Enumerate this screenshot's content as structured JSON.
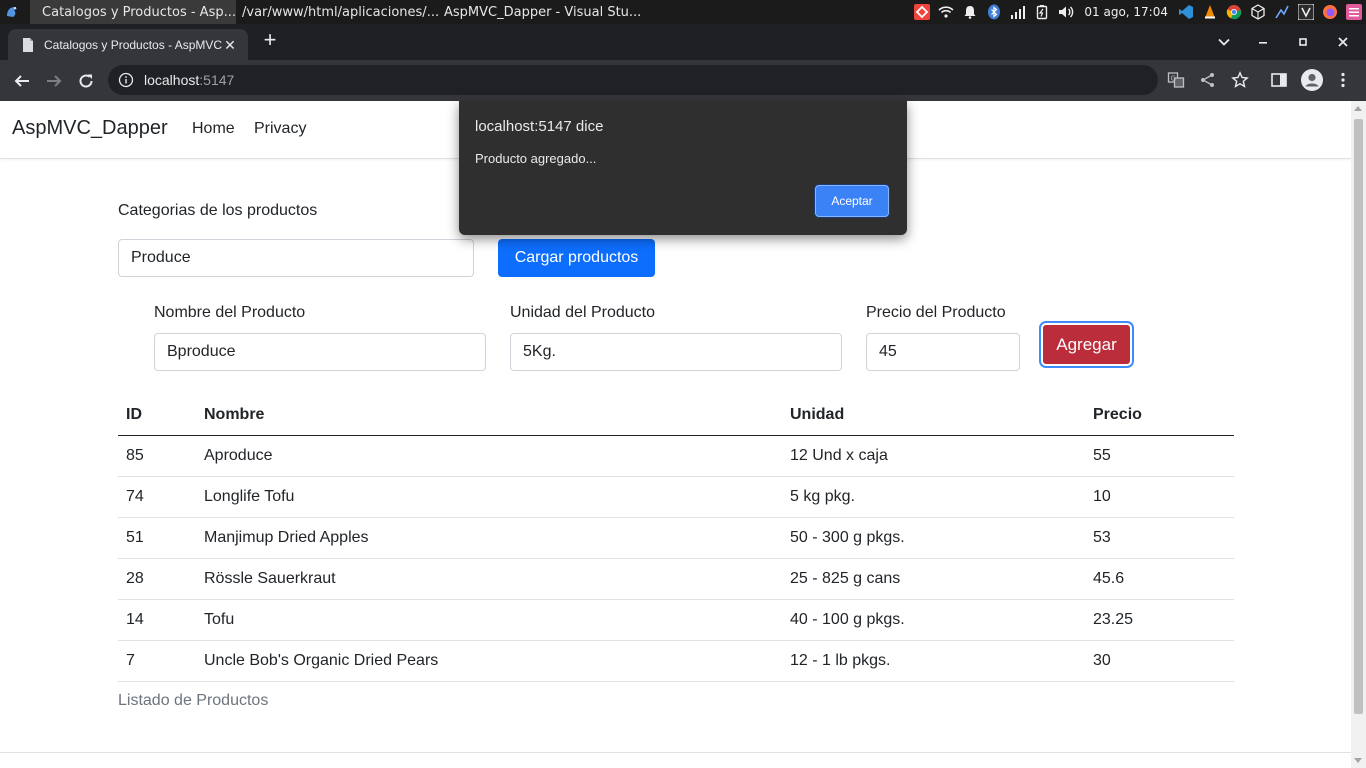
{
  "taskbar": {
    "tasks": [
      {
        "label": "Catalogos y Productos - Asp..."
      },
      {
        "label": "/var/www/html/aplicaciones/..."
      },
      {
        "label": "AspMVC_Dapper - Visual Stu..."
      }
    ],
    "clock": "01 ago, 17:04"
  },
  "browser": {
    "tab_title": "Catalogos y Productos - AspMVC_Dapper",
    "url_host": "localhost",
    "url_port": ":5147"
  },
  "app": {
    "brand": "AspMVC_Dapper",
    "nav": {
      "home": "Home",
      "privacy": "Privacy"
    }
  },
  "form": {
    "categories_label": "Categorias de los productos",
    "category_value": "Produce",
    "load_button": "Cargar productos",
    "name_label": "Nombre del Producto",
    "name_value": "Bproduce",
    "unit_label": "Unidad del Producto",
    "unit_value": "5Kg.",
    "price_label": "Precio del Producto",
    "price_value": "45",
    "add_button": "Agregar"
  },
  "table": {
    "headers": {
      "id": "ID",
      "name": "Nombre",
      "unit": "Unidad",
      "price": "Precio"
    },
    "rows": [
      {
        "id": "85",
        "name": "Aproduce",
        "unit": "12 Und x caja",
        "price": "55"
      },
      {
        "id": "74",
        "name": "Longlife Tofu",
        "unit": "5 kg pkg.",
        "price": "10"
      },
      {
        "id": "51",
        "name": "Manjimup Dried Apples",
        "unit": "50 - 300 g pkgs.",
        "price": "53"
      },
      {
        "id": "28",
        "name": "Rössle Sauerkraut",
        "unit": "25 - 825 g cans",
        "price": "45.6"
      },
      {
        "id": "14",
        "name": "Tofu",
        "unit": "40 - 100 g pkgs.",
        "price": "23.25"
      },
      {
        "id": "7",
        "name": "Uncle Bob's Organic Dried Pears",
        "unit": "12 - 1 lb pkgs.",
        "price": "30"
      }
    ],
    "caption": "Listado de Productos"
  },
  "dialog": {
    "title": "localhost:5147 dice",
    "message": "Producto agregado...",
    "ok_button": "Aceptar"
  },
  "colors": {
    "primary": "#0d6efd",
    "danger": "#bb2d3b",
    "dialog_bg": "#2f2f2f",
    "dialog_button": "#3b82f6"
  }
}
